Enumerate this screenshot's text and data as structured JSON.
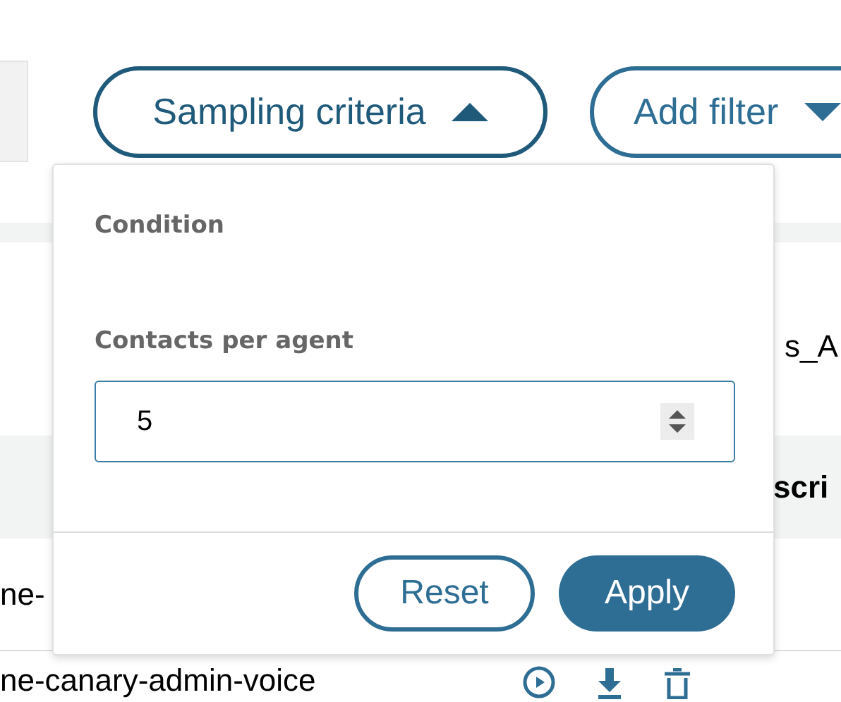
{
  "toolbar": {
    "sampling_button": {
      "label": "Sampling criteria",
      "expanded": true
    },
    "add_filter_button": {
      "label": "Add filter"
    }
  },
  "popover": {
    "section_title": "Condition",
    "field": {
      "label": "Contacts per agent",
      "value": "5"
    },
    "buttons": [
      {
        "label": "Reset",
        "kind": "secondary"
      },
      {
        "label": "Apply",
        "kind": "primary"
      }
    ]
  },
  "table": {
    "row_text": "s_A",
    "header_text": "scri",
    "rows": [
      {
        "name": "ne-",
        "actions": false
      },
      {
        "name": "ne-canary-admin-voice",
        "actions": true
      }
    ]
  }
}
